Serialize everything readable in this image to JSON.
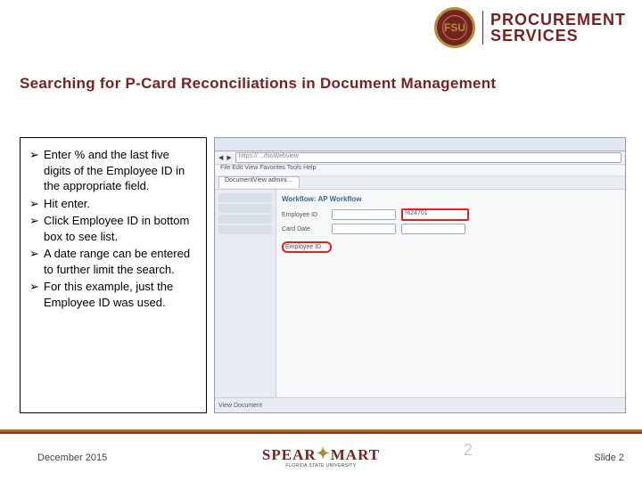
{
  "header": {
    "seal": "FSU",
    "brand1": "PROCUREMENT",
    "brand2": "SERVICES"
  },
  "title": "Searching for P-Card Reconciliations in Document Management",
  "bullets": [
    "Enter % and the last five digits of the Employee ID in the appropriate field.",
    "Hit enter.",
    "Click Employee ID in bottom box to see list.",
    "A date range can be entered to further limit the search.",
    "For this example, just the Employee ID was used."
  ],
  "screenshot": {
    "url": "https://…/NoWebview",
    "menu": "File  Edit  View  Favorites  Tools  Help",
    "tab": "DocumentView admini…",
    "panel_title": "Workflow: AP Workflow",
    "row1_label": "Employee ID",
    "row1_val": "%24701",
    "row2_label": "Card Date",
    "chk1": "Employee ID",
    "footer": "View Document"
  },
  "footer": {
    "date": "December 2015",
    "logo": "SPEAR",
    "logo2": "MART",
    "sub": "FLORIDA STATE UNIVERSITY",
    "pagenum_ghost": "2",
    "slide": "Slide 2"
  }
}
